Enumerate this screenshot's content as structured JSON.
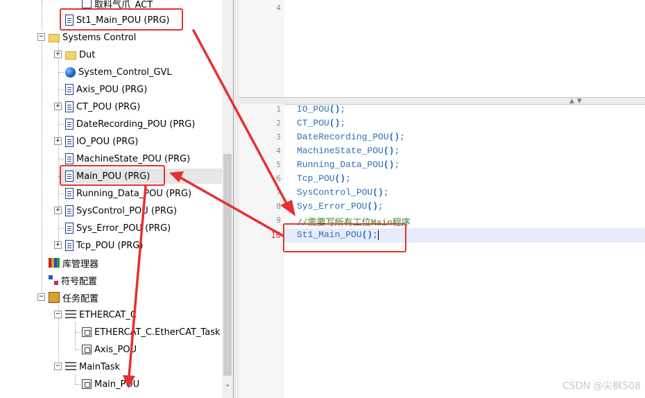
{
  "tree": {
    "items": [
      {
        "label": "取料气爪_ACT",
        "icon": "action-icon"
      },
      {
        "label": "St1_Main_POU (PRG)",
        "icon": "pou-document-icon"
      },
      {
        "label": "Systems Control",
        "icon": "folder-icon"
      },
      {
        "label": "Dut",
        "icon": "folder-icon"
      },
      {
        "label": "System_Control_GVL",
        "icon": "globe-icon"
      },
      {
        "label": "Axis_POU (PRG)",
        "icon": "pou-document-icon"
      },
      {
        "label": "CT_POU (PRG)",
        "icon": "pou-document-icon"
      },
      {
        "label": "DateRecording_POU (PRG)",
        "icon": "pou-document-icon"
      },
      {
        "label": "IO_POU (PRG)",
        "icon": "pou-document-icon"
      },
      {
        "label": "MachineState_POU (PRG)",
        "icon": "pou-document-icon"
      },
      {
        "label": "Main_POU (PRG)",
        "icon": "pou-document-icon"
      },
      {
        "label": "Running_Data_POU (PRG)",
        "icon": "pou-document-icon"
      },
      {
        "label": "SysControl_POU (PRG)",
        "icon": "pou-document-icon"
      },
      {
        "label": "Sys_Error_POU (PRG)",
        "icon": "pou-document-icon"
      },
      {
        "label": "Tcp_POU (PRG)",
        "icon": "pou-document-icon"
      },
      {
        "label": "库管理器",
        "icon": "library-manager-icon"
      },
      {
        "label": "符号配置",
        "icon": "symbol-config-icon"
      },
      {
        "label": "任务配置",
        "icon": "task-config-icon"
      },
      {
        "label": "ETHERCAT_C",
        "icon": "task-stack-icon"
      },
      {
        "label": "ETHERCAT_C.EtherCAT_Task",
        "icon": "task-call-icon"
      },
      {
        "label": "Axis_POU",
        "icon": "task-call-icon"
      },
      {
        "label": "MainTask",
        "icon": "task-stack-icon"
      },
      {
        "label": "Main_POU",
        "icon": "task-call-icon"
      }
    ]
  },
  "editor_top": {
    "lines": [
      {
        "num": "4"
      }
    ]
  },
  "editor": {
    "lines": [
      {
        "num": "1",
        "text": "IO_POU",
        "suffix": ";"
      },
      {
        "num": "2",
        "text": "CT_POU",
        "suffix": ";"
      },
      {
        "num": "3",
        "text": "DateRecording_POU",
        "suffix": ";"
      },
      {
        "num": "4",
        "text": "MachineState_POU",
        "suffix": ";"
      },
      {
        "num": "5",
        "text": "Running_Data_POU",
        "suffix": ";"
      },
      {
        "num": "6",
        "text": "Tcp_POU",
        "suffix": ";"
      },
      {
        "num": "7",
        "text": "SysControl_POU",
        "suffix": ";"
      },
      {
        "num": "8",
        "text": "Sys_Error_POU",
        "suffix": ";"
      },
      {
        "num": "9",
        "comment": "//需要写所有工位Main程序"
      },
      {
        "num": "10",
        "text": "St1_Main_POU",
        "suffix": ";"
      }
    ],
    "paren": "()"
  },
  "watermark": "CSDN @尖枫508",
  "colors": {
    "annotation_red": "#e53030",
    "code_blue": "#2a6fb8",
    "comment_green": "#2a8a2a",
    "current_line": "#e8ebfa"
  }
}
